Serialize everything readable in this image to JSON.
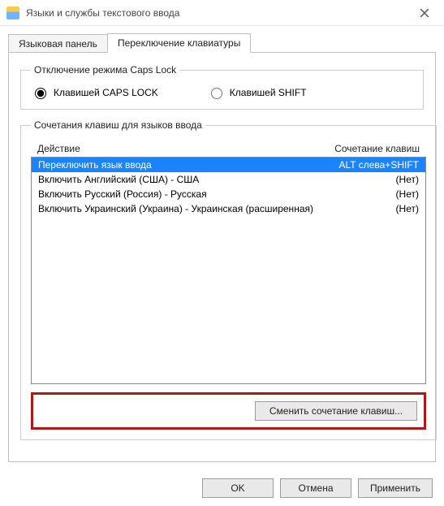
{
  "window": {
    "title": "Языки и службы текстового ввода"
  },
  "tabs": {
    "lang_panel": "Языковая панель",
    "keyboard_switch": "Переключение клавиатуры"
  },
  "capslock_group": {
    "legend": "Отключение режима Caps Lock",
    "option_caps": "Клавишей CAPS LOCK",
    "option_shift": "Клавишей SHIFT"
  },
  "hotkeys_group": {
    "legend": "Сочетания клавиш для языков ввода",
    "head_action": "Действие",
    "head_combo": "Сочетание клавиш",
    "rows": [
      {
        "action": "Переключить язык ввода",
        "combo": "ALT слева+SHIFT",
        "selected": true
      },
      {
        "action": "Включить Английский (США) - США",
        "combo": "(Нет)",
        "selected": false
      },
      {
        "action": "Включить Русский (Россия) - Русская",
        "combo": "(Нет)",
        "selected": false
      },
      {
        "action": "Включить Украинский (Украина) - Украинская (расширенная)",
        "combo": "(Нет)",
        "selected": false
      }
    ],
    "change_btn": "Сменить сочетание клавиш..."
  },
  "buttons": {
    "ok": "OK",
    "cancel": "Отмена",
    "apply": "Применить"
  }
}
